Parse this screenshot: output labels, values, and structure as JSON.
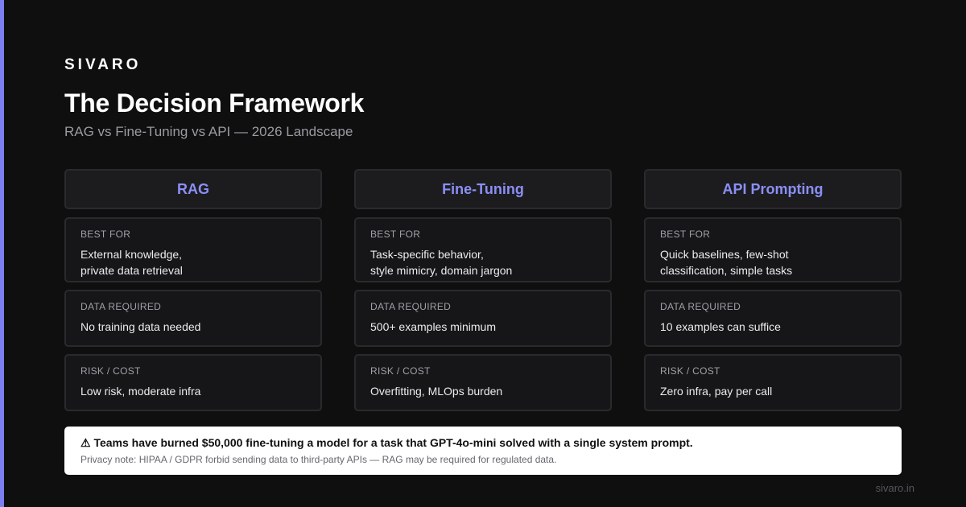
{
  "brand": "SIVARO",
  "title": "The Decision Framework",
  "subtitle": "RAG vs Fine-Tuning vs API — 2026 Landscape",
  "colors": {
    "accent": "#7b7ff0",
    "column_title": "#8b8ff5",
    "background": "#0f0f10"
  },
  "columns": [
    {
      "title": "RAG",
      "best_for_label": "BEST FOR",
      "best_for": "External knowledge,\nprivate data retrieval",
      "data_label": "DATA REQUIRED",
      "data": "No training data needed",
      "risk_label": "RISK / COST",
      "risk": "Low risk, moderate infra"
    },
    {
      "title": "Fine-Tuning",
      "best_for_label": "BEST FOR",
      "best_for": "Task-specific behavior,\nstyle mimicry, domain jargon",
      "data_label": "DATA REQUIRED",
      "data": "500+ examples minimum",
      "risk_label": "RISK / COST",
      "risk": "Overfitting, MLOps burden"
    },
    {
      "title": "API Prompting",
      "best_for_label": "BEST FOR",
      "best_for": "Quick baselines, few-shot\nclassification, simple tasks",
      "data_label": "DATA REQUIRED",
      "data": "10 examples can suffice",
      "risk_label": "RISK / COST",
      "risk": "Zero infra, pay per call"
    }
  ],
  "callout": {
    "main": "⚠ Teams have burned $50,000 fine-tuning a model for a task that GPT-4o-mini solved with a single system prompt.",
    "note": "Privacy note: HIPAA / GDPR forbid sending data to third-party APIs — RAG may be required for regulated data."
  },
  "footer": "sivaro.in"
}
